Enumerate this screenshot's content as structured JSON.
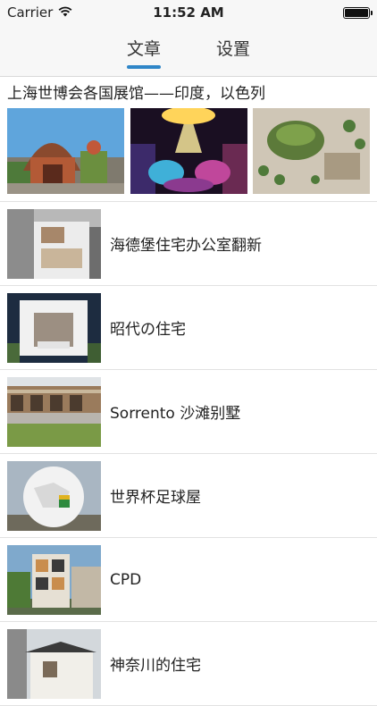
{
  "status_bar": {
    "carrier": "Carrier",
    "time": "11:52 AM"
  },
  "tabs": [
    {
      "label": "文章",
      "active": true
    },
    {
      "label": "设置",
      "active": false
    }
  ],
  "featured": {
    "title": "上海世博会各国展馆——印度，以色列",
    "images": [
      "india-pavilion-photo",
      "pavilion-interior-photo",
      "pavilion-aerial-photo"
    ]
  },
  "articles": [
    {
      "title": "海德堡住宅办公室翻新",
      "thumb": "heidelberg-house-photo"
    },
    {
      "title": "昭代の住宅",
      "thumb": "showa-house-photo"
    },
    {
      "title": "Sorrento 沙滩别墅",
      "thumb": "sorrento-villa-photo"
    },
    {
      "title": "世界杯足球屋",
      "thumb": "football-house-photo"
    },
    {
      "title": "CPD",
      "thumb": "cpd-building-photo"
    },
    {
      "title": "神奈川的住宅",
      "thumb": "kanagawa-house-photo"
    }
  ],
  "colors": {
    "accent": "#2f86c8",
    "bar_bg": "#f7f7f7",
    "separator": "#e2e2e2"
  }
}
